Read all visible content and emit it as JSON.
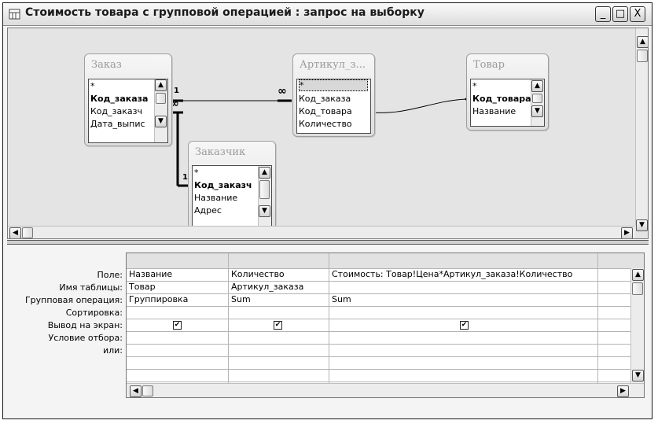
{
  "window": {
    "title": "Стоимость товара с групповой операцией : запрос на выборку",
    "icon": "query-icon",
    "minimize": "_",
    "maximize": "□",
    "close": "X"
  },
  "tables": [
    {
      "name": "Заказ",
      "fields": [
        "*",
        "Код_заказа",
        "Код_заказч",
        "Дата_выпис"
      ],
      "bold_index": 1
    },
    {
      "name": "Артикул_з...",
      "fields": [
        "*",
        "Код_заказа",
        "Код_товара",
        "Количество"
      ],
      "bold_index": -1
    },
    {
      "name": "Товар",
      "fields": [
        "*",
        "Код_товара",
        "Название"
      ],
      "bold_index": 1
    },
    {
      "name": "Заказчик",
      "fields": [
        "*",
        "Код_заказч",
        "Название",
        "Адрес"
      ],
      "bold_index": 1
    }
  ],
  "relations": {
    "one": "1",
    "many": "∞"
  },
  "grid": {
    "row_labels": [
      "Поле:",
      "Имя таблицы:",
      "Групповая операция:",
      "Сортировка:",
      "Вывод на экран:",
      "Условие отбора:",
      "или:"
    ],
    "columns": [
      {
        "field": "Название",
        "table": "Товар",
        "group": "Группировка",
        "sort": "",
        "show": true
      },
      {
        "field": "Количество",
        "table": "Артикул_заказа",
        "group": "Sum",
        "sort": "",
        "show": true
      },
      {
        "field": "Стоимость: Товар!Цена*Артикул_заказа!Количество",
        "table": "",
        "group": "Sum",
        "sort": "",
        "show": true
      },
      {
        "field": "",
        "table": "",
        "group": "",
        "sort": "",
        "show": false
      }
    ]
  },
  "glyphs": {
    "up": "▲",
    "down": "▼",
    "left": "◀",
    "right": "▶",
    "check": "✔"
  }
}
